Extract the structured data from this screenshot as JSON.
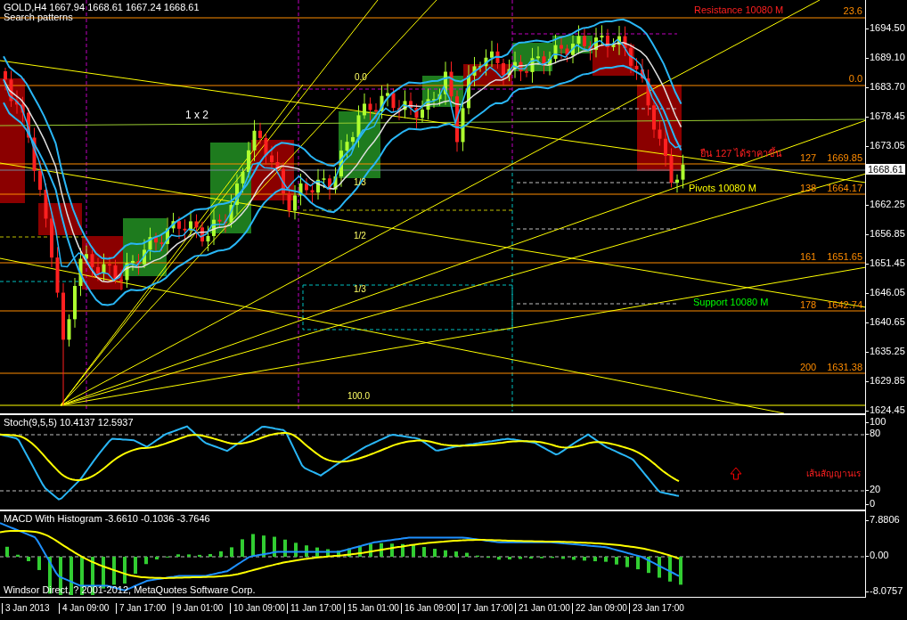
{
  "header": {
    "symbol_line": "GOLD,H4  1667.94 1668.61 1667.24 1668.61",
    "subtitle": "Search patterns"
  },
  "main_chart": {
    "fib_levels": [
      {
        "ratio": "23.6"
      },
      {
        "ratio": "0.0"
      },
      {
        "ratio": "127",
        "price": "1669.85"
      },
      {
        "ratio": "138",
        "price": "1664.17"
      },
      {
        "ratio": "161",
        "price": "1651.65"
      },
      {
        "ratio": "178",
        "price": "1642.74"
      },
      {
        "ratio": "200",
        "price": "1631.38"
      }
    ],
    "annotations": [
      {
        "text": "Resistance 10080 M",
        "kind": "resistance"
      },
      {
        "text": "ยืน 127 ได้ราคาขึ้น",
        "kind": "note"
      },
      {
        "text": "Pivots 10080 M",
        "kind": "pivot"
      },
      {
        "text": "Support 10080 M",
        "kind": "support"
      },
      {
        "text": "1 x 2",
        "kind": "ratio"
      }
    ],
    "fan_labels": [
      "0.0",
      "1/3",
      "1/2",
      "1/3",
      "100.0"
    ],
    "price_axis": [
      "1694.50",
      "1689.10",
      "1683.70",
      "1678.45",
      "1673.05",
      "1662.25",
      "1656.85",
      "1651.45",
      "1646.05",
      "1640.65",
      "1635.25",
      "1629.85",
      "1624.45"
    ],
    "current_price": "1668.61"
  },
  "stochastic": {
    "title": "Stoch(9,5,5) 10.4137 12.5937",
    "note": "เส้นสัญญานเร",
    "axis": [
      "100",
      "80",
      "20",
      "0"
    ]
  },
  "macd": {
    "title": "MACD With Histogram -3.6610 -0.1036 -3.7646",
    "copyright": "Windsor Direct, ? 2001-2012, MetaQuotes Software Corp.",
    "axis": [
      "7.8806",
      "0.00",
      "-8.0757"
    ]
  },
  "time_axis": [
    "3 Jan 2013",
    "4 Jan 09:00",
    "7 Jan 17:00",
    "9 Jan 01:00",
    "10 Jan 09:00",
    "11 Jan 17:00",
    "15 Jan 01:00",
    "16 Jan 09:00",
    "17 Jan 17:00",
    "21 Jan 01:00",
    "22 Jan 09:00",
    "23 Jan 17:00"
  ]
}
